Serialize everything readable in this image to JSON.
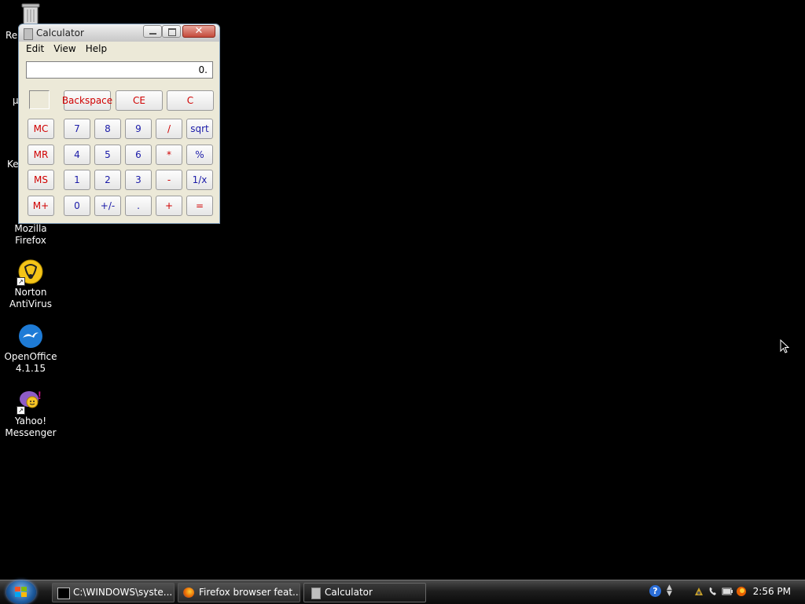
{
  "desktop": {
    "partial_labels": {
      "recycle": "Re",
      "mu": "µ",
      "ke": "Ke"
    },
    "icons": [
      {
        "label_line1": "Mozilla",
        "label_line2": "Firefox"
      },
      {
        "label_line1": "Norton",
        "label_line2": "AntiVirus"
      },
      {
        "label_line1": "OpenOffice",
        "label_line2": "4.1.15"
      },
      {
        "label_line1": "Yahoo!",
        "label_line2": "Messenger"
      }
    ]
  },
  "calculator": {
    "title": "Calculator",
    "close_symbol": "✕",
    "menu": [
      "Edit",
      "View",
      "Help"
    ],
    "display": "0.",
    "top_buttons": [
      "Backspace",
      "CE",
      "C"
    ],
    "rows": [
      [
        "MC",
        "7",
        "8",
        "9",
        "/",
        "sqrt"
      ],
      [
        "MR",
        "4",
        "5",
        "6",
        "*",
        "%"
      ],
      [
        "MS",
        "1",
        "2",
        "3",
        "-",
        "1/x"
      ],
      [
        "M+",
        "0",
        "+/-",
        ".",
        "+",
        "="
      ]
    ]
  },
  "taskbar": {
    "tasks": [
      "C:\\WINDOWS\\syste...",
      "Firefox browser feat...",
      "Calculator"
    ],
    "clock": "2:56 PM",
    "help_symbol": "?"
  },
  "colors": {
    "accent_red": "#d00000",
    "accent_blue": "#1a1aa8"
  }
}
